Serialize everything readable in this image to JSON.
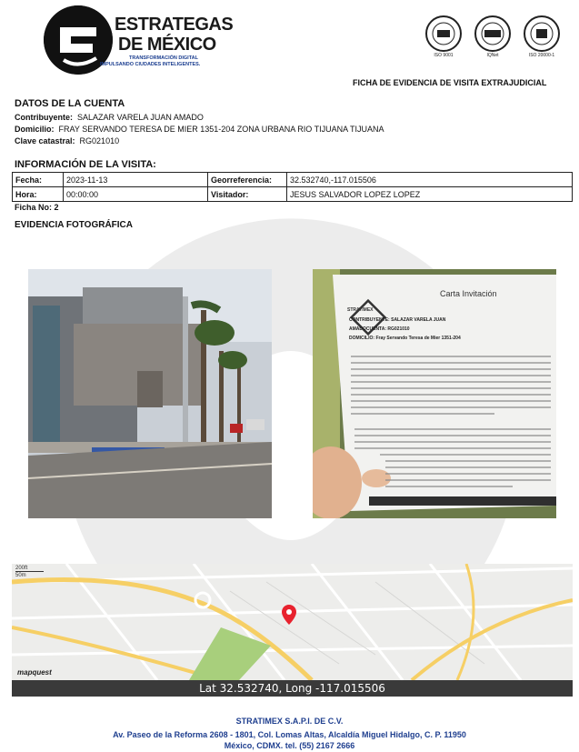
{
  "header": {
    "brand_line1": "ESTRATEGAS",
    "brand_line2": "DE MÉXICO",
    "tagline1": "TRANSFORMACIÓN DIGITAL",
    "tagline2": "IMPULSANDO CIUDADES INTELIGENTES.",
    "cert_labels": [
      "ISO 9001",
      "IQNet",
      "ISO 20000-1"
    ],
    "doc_title": "FICHA DE EVIDENCIA DE VISITA EXTRAJUDICIAL"
  },
  "account": {
    "title": "DATOS DE LA CUENTA",
    "contribuyente_label": "Contribuyente:",
    "contribuyente": "SALAZAR VARELA JUAN AMADO",
    "domicilio_label": "Domicilio:",
    "domicilio": "FRAY SERVANDO TERESA DE MIER 1351-204   ZONA URBANA RIO TIJUANA TIJUANA",
    "clave_label": "Clave catastral:",
    "clave": "RG021010"
  },
  "visit": {
    "title": "INFORMACIÓN DE LA VISITA:",
    "fecha_label": "Fecha:",
    "fecha": "2023-11-13",
    "geo_label": "Georreferencia:",
    "geo": "32.532740,-117.015506",
    "hora_label": "Hora:",
    "hora": "00:00:00",
    "visitador_label": "Visitador:",
    "visitador": "JESUS SALVADOR LOPEZ LOPEZ",
    "ficha_no": "Ficha No: 2"
  },
  "evidence": {
    "title": "EVIDENCIA FOTOGRÁFICA",
    "letter_brand": "STRATIMEX",
    "letter_title": "Carta Invitación",
    "letter_contribuyente": "CONTRIBUYENTE: SALAZAR VARELA JUAN",
    "letter_amadocuenta": "AMADOCUENTA: RG021010",
    "letter_domicilio": "DOMICILIO: Fray Servando Teresa de Mier 1351-204"
  },
  "map": {
    "scale_top": "200ft",
    "scale_bottom": "50m",
    "attribution": "mapquest",
    "coords": "Lat 32.532740, Long -117.015506"
  },
  "footer": {
    "company": "STRATIMEX S.A.P.I. DE C.V.",
    "address1": "Av. Paseo de la Reforma 2608 - 1801, Col. Lomas Altas, Alcaldía Miguel Hidalgo, C. P. 11950",
    "address2": "México, CDMX. tel. (55) 2167 2666"
  },
  "colors": {
    "accent_blue": "#1f3f8f",
    "map_pin": "#e8222e",
    "map_highway": "#f6cf65",
    "map_park": "#a8cf7c"
  }
}
